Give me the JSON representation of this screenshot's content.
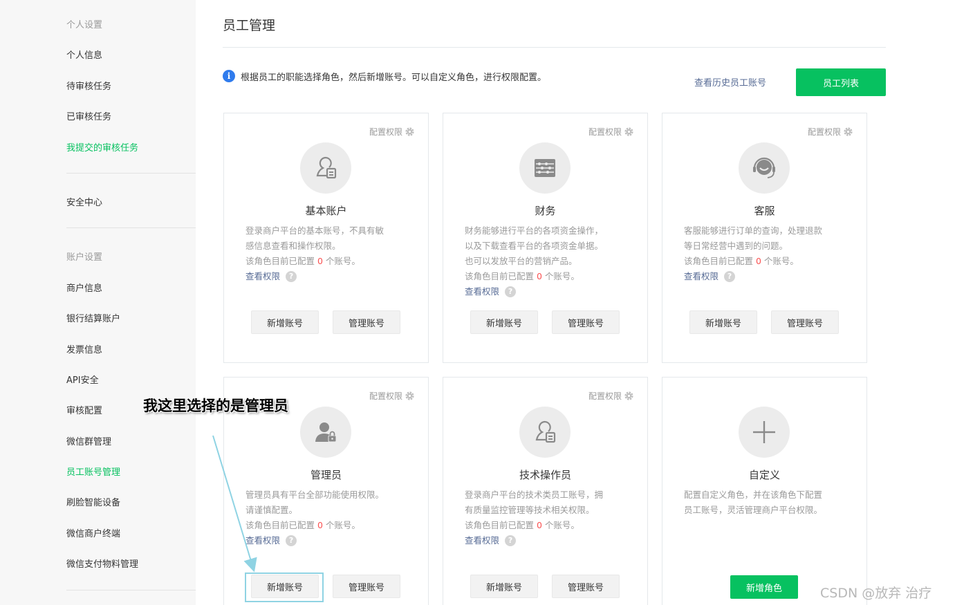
{
  "sidebar": {
    "cat_personal": "个人设置",
    "personal_info": "个人信息",
    "pending_tasks": "待审核任务",
    "reviewed_tasks": "已审核任务",
    "my_submitted_tasks": "我提交的审核任务",
    "security_center": "安全中心",
    "cat_account": "账户设置",
    "merchant_info": "商户信息",
    "bank_account": "银行结算账户",
    "invoice_info": "发票信息",
    "api_security": "API安全",
    "review_config": "审核配置",
    "wechat_group": "微信群管理",
    "staff_account": "员工账号管理",
    "face_device": "刷脸智能设备",
    "merchant_terminal": "微信商户终端",
    "pay_materials": "微信支付物料管理"
  },
  "header": {
    "title": "员工管理",
    "info": "根据员工的职能选择角色，然后新增账号。可以自定义角色，进行权限配置。",
    "history_link": "查看历史员工账号",
    "staff_list_button": "员工列表"
  },
  "common": {
    "config_perm": "配置权限",
    "view_perm": "查看权限",
    "add_account": "新增账号",
    "manage_account": "管理账号",
    "count_prefix": "该角色目前已配置 ",
    "count_suffix": " 个账号。"
  },
  "roles": [
    {
      "name": "基本账户",
      "desc1": "登录商户平台的基本账号，不具有敏",
      "desc2": "感信息查看和操作权限。",
      "count": "0"
    },
    {
      "name": "财务",
      "desc1": "财务能够进行平台的各项资金操作，",
      "desc2": "以及下载查看平台的各项资金单据。",
      "desc3": "也可以发放平台的营销产品。",
      "count": "0"
    },
    {
      "name": "客服",
      "desc1": "客服能够进行订单的查询，处理退款",
      "desc2": "等日常经营中遇到的问题。",
      "count": "0"
    },
    {
      "name": "管理员",
      "desc1": "管理员具有平台全部功能使用权限。",
      "desc2": "请谨慎配置。",
      "count": "0"
    },
    {
      "name": "技术操作员",
      "desc1": "登录商户平台的技术类员工账号，拥",
      "desc2": "有质量监控管理等技术相关权限。",
      "count": "0"
    }
  ],
  "custom": {
    "name": "自定义",
    "desc1": "配置自定义角色，并在该角色下配置",
    "desc2": "员工账号，灵活管理商户平台权限。",
    "button": "新增角色"
  },
  "annotation": "我这里选择的是管理员",
  "watermark": "CSDN @放弃      治疗",
  "colors": {
    "brand_green": "#07c160",
    "link_blue": "#576b95",
    "count_red": "#fa5151",
    "info_blue": "#2f7bed"
  }
}
